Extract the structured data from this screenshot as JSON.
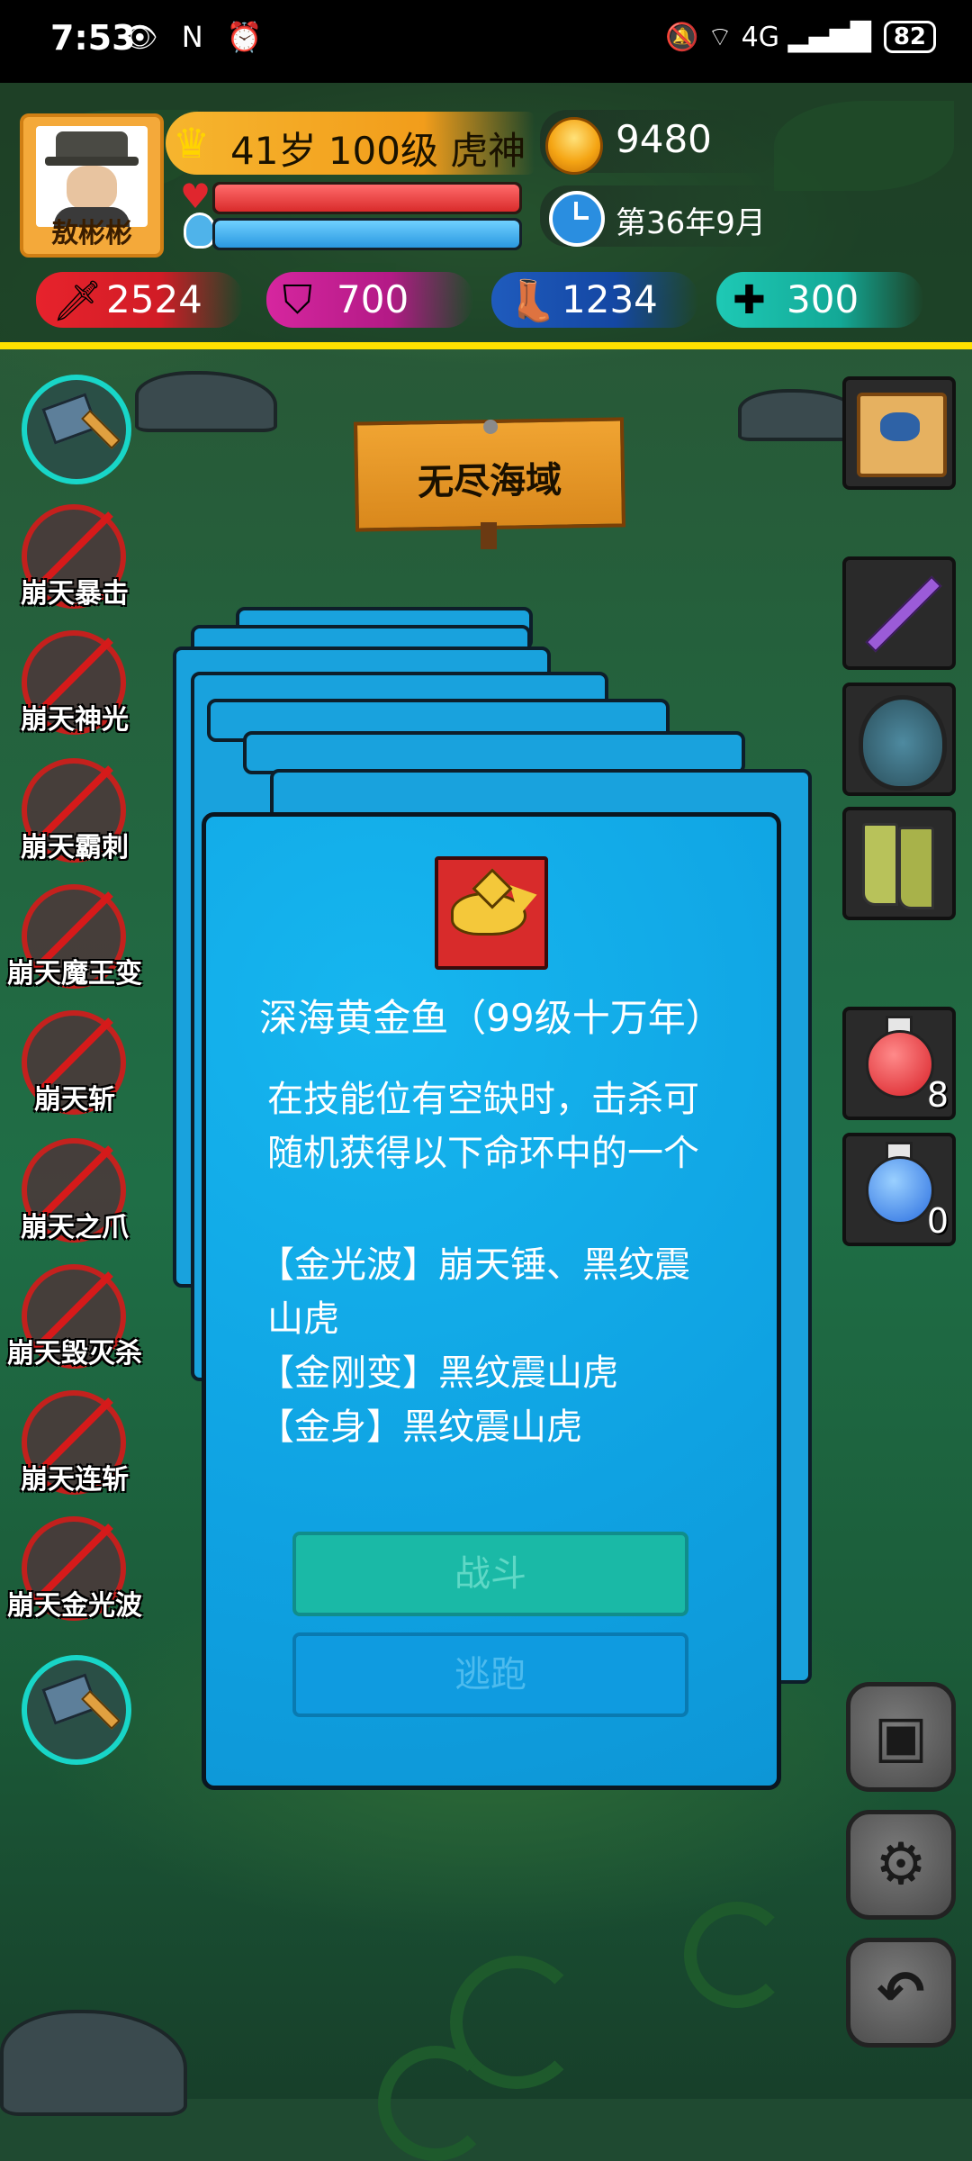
{
  "status_bar": {
    "time": "7:53",
    "left_icons": "👁 N ⏰",
    "right_icons": "🔕 ⌔ 4G ▂▄▆█",
    "battery": "82"
  },
  "hud": {
    "player_name": "敖彬彬",
    "level_text": "41岁 100级 虎神",
    "gold": "9480",
    "date": "第36年9月",
    "hp_ratio": 1.0,
    "mp_ratio": 1.0,
    "stats": {
      "attack": "2524",
      "defense": "700",
      "speed": "1234",
      "health": "300"
    }
  },
  "location_sign": "无尽海域",
  "skills": [
    "崩天暴击",
    "崩天神光",
    "崩天霸刺",
    "崩天魔王变",
    "崩天斩",
    "崩天之爪",
    "崩天毁灭杀",
    "崩天连斩",
    "崩天金光波"
  ],
  "inventory": {
    "red_potion_count": "8",
    "blue_potion_count": "0"
  },
  "encounter_card": {
    "title": "深海黄金鱼（99级十万年）",
    "desc_line1": "在技能位有空缺时，击杀可",
    "desc_line2": "随机获得以下命环中的一个",
    "ring_line1": "【金光波】崩天锤、黑纹震",
    "ring_line2": "山虎",
    "ring_line3": "【金刚变】黑纹震山虎",
    "ring_line4": "【金身】黑纹震山虎",
    "fight_label": "战斗",
    "flee_label": "逃跑"
  },
  "colors": {
    "hud_line": "#ffe100",
    "card_blue": "#0fa2e2",
    "fight_btn": "#1ab9a6",
    "flee_btn": "#0f9be0"
  }
}
